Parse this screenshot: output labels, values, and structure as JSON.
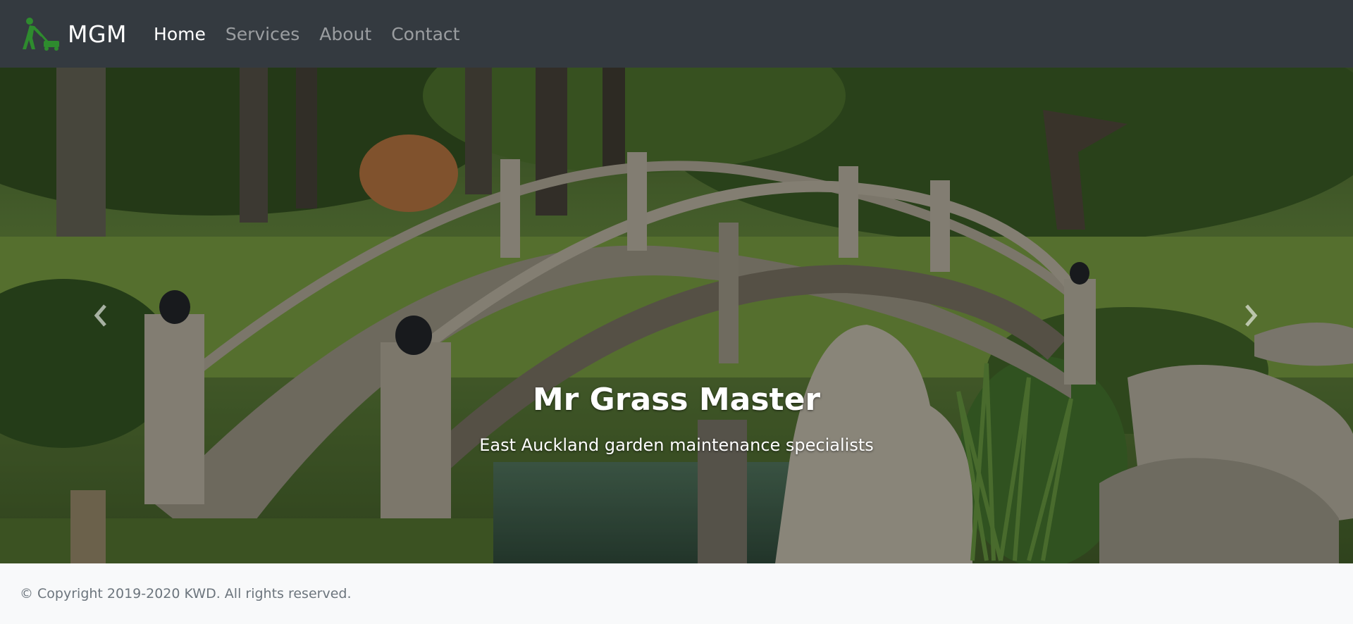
{
  "navbar": {
    "brand": "MGM",
    "brand_icon": "lawn-mower-icon",
    "links": [
      {
        "label": "Home",
        "active": true
      },
      {
        "label": "Services",
        "active": false
      },
      {
        "label": "About",
        "active": false
      },
      {
        "label": "Contact",
        "active": false
      }
    ]
  },
  "carousel": {
    "image": "japanese-garden-bridge",
    "caption_title": "Mr Grass Master",
    "caption_subtitle": "East Auckland garden maintenance specialists",
    "prev_icon": "chevron-left-icon",
    "next_icon": "chevron-right-icon"
  },
  "footer": {
    "copyright": "© Copyright 2019-2020 KWD. All rights reserved."
  },
  "colors": {
    "navbar_bg": "#343a40",
    "footer_bg": "#f8f9fa",
    "logo_green": "#2e8b2e"
  }
}
